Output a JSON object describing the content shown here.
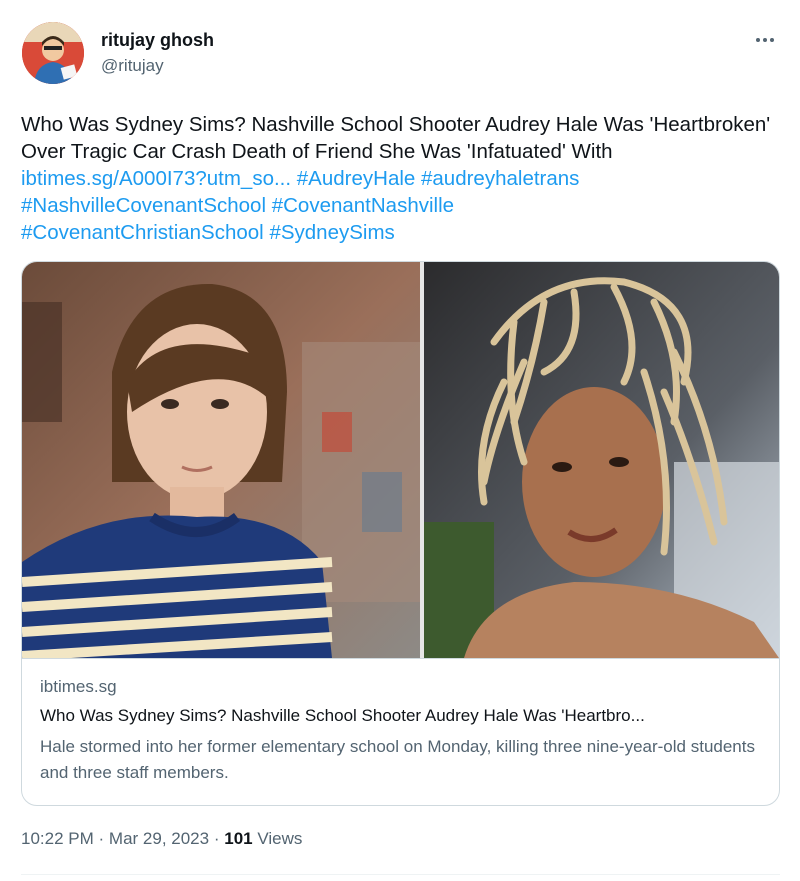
{
  "author": {
    "name": "ritujay ghosh",
    "handle": "@ritujay",
    "avatar_icon": "user-avatar-icon"
  },
  "tweet": {
    "text_parts": [
      "Who Was Sydney Sims? Nashville School Shooter Audrey Hale Was 'Heartbroken' Over Tragic Car Crash Death of Friend She Was 'Infatuated' With ",
      " ",
      " "
    ],
    "link": "ibtimes.sg/A000I73?utm_so...",
    "hashtags": [
      "#AudreyHale",
      "#audreyhaletrans",
      "#NashvilleCovenantSchool",
      "#CovenantNashville",
      "#CovenantChristianSchool",
      "#SydneySims"
    ]
  },
  "card": {
    "domain": "ibtimes.sg",
    "title": "Who Was Sydney Sims? Nashville School Shooter Audrey Hale Was 'Heartbro...",
    "description": "Hale stormed into her former elementary school on Monday, killing three nine-year-old students and three staff members."
  },
  "meta": {
    "time": "10:22 PM",
    "separator": "·",
    "date": "Mar 29, 2023",
    "views_count": "101",
    "views_label": "Views"
  },
  "colors": {
    "link": "#1d9bf0",
    "secondary_text": "#536471",
    "border": "#cfd9de"
  }
}
